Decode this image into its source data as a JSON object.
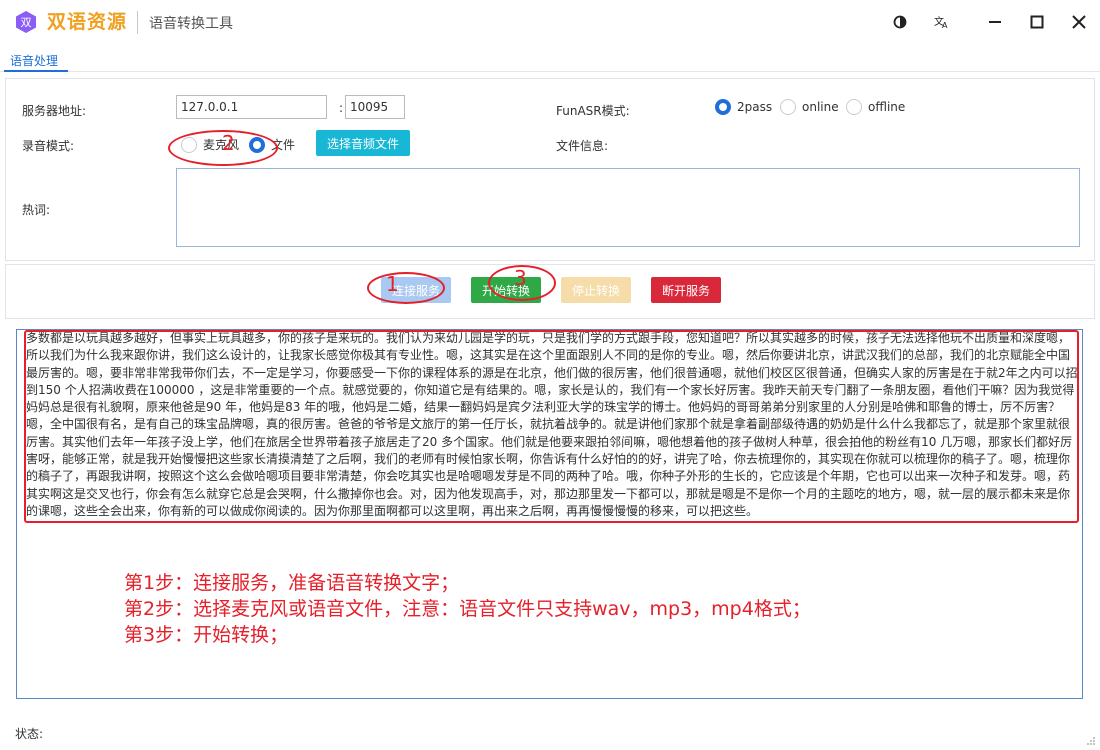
{
  "app": {
    "name": "双语资源",
    "logo_text": "双",
    "subtitle": "语音转换工具"
  },
  "titlebar": {
    "icons": [
      "theme-icon",
      "translate-icon",
      "minimize-icon",
      "maximize-icon",
      "close-icon"
    ]
  },
  "tabs": [
    {
      "label": "语音处理",
      "active": true
    }
  ],
  "form": {
    "server_label": "服务器地址:",
    "server_value": "127.0.0.1",
    "port_sep": ":",
    "port_value": "10095",
    "funasr_label": "FunASR模式:",
    "funasr_options": [
      "2pass",
      "online",
      "offline"
    ],
    "funasr_selected": "2pass",
    "record_label": "录音模式:",
    "record_options": [
      "麦克风",
      "文件"
    ],
    "record_selected": "文件",
    "select_file_button": "选择音频文件",
    "file_info_label": "文件信息:",
    "hotword_label": "热词:",
    "hotword_value": ""
  },
  "actions": {
    "connect": "连接服务",
    "start": "开始转换",
    "stop": "停止转换",
    "disconnect": "断开服务"
  },
  "annotations": {
    "num1": "1",
    "num2": "2",
    "num3": "3"
  },
  "transcript": "多数都是以玩具越多越好，但事实上玩具越多，你的孩子是来玩的。我们认为来幼儿园是学的玩，只是我们学的方式跟手段，您知道吧？所以其实越多的时候，孩子无法选择他玩不出质量和深度嗯，所以我们为什么我来跟你讲，我们这么设计的，让我家长感觉你极其有专业性。嗯，这其实是在这个里面跟别人不同的是你的专业。嗯，然后你要讲北京，讲武汉我们的总部，我们的北京赋能全中国最厉害的。嗯，要非常非常我带你们去，不一定是学习，你要感受一下你的课程体系的源是在北京，他们做的很厉害，他们很普通嗯，就他们校区区很普通，但确实人家的厉害是在于就2年之内可以招到150 个人招满收费在100000 ，这是非常重要的一个点。就感觉要的，你知道它是有结果的。嗯，家长是认的，我们有一个家长好厉害。我昨天前天专门翻了一条朋友圈，看他们干嘛？因为我觉得妈妈总是很有礼貌啊，原来他爸是90 年，他妈是83 年的哦，他妈是二婚，结果一翻妈妈是宾夕法利亚大学的珠宝学的博士。他妈妈的哥哥弟弟分别家里的人分别是哈佛和耶鲁的博士，厉不厉害？嗯，全中国很有名，是有自己的珠宝品牌嗯，真的很厉害。爸爸的爷爷是文旅厅的第一任厅长，就抗着战争的。就是讲他们家那个就是拿着副部级待遇的奶奶是什么什么我都忘了，就是那个家里就很厉害。其实他们去年一年孩子没上学，他们在旅居全世界带着孩子旅居走了20 多个国家。他们就是他要来跟拍邻间嘛，嗯他想着他的孩子做树人种草，很会拍他的粉丝有10 几万嗯，那家长们都好厉害呀，能够正常，就是我开始慢慢把这些家长清摸清楚了之后啊，我们的老师有时候怕家长啊，你告诉有什么好怕的的好，讲完了哈，你去梳理你的，其实现在你就可以梳理你的稿子了。嗯，梳理你的稿子了，再跟我讲啊，按照这个这么会做哈嗯项目要非常清楚，你会吃其实也是哈嗯嗯发芽是不同的两种了哈。哦，你种子外形的生长的，它应该是个年期，它也可以出来一次种子和发芽。嗯，药其实啊这是交叉也行，你会有怎么就穿它总是会哭啊，什么撒掉你也会。对，因为他发现高手，对，那边那里发一下都可以，那就是嗯是不是你一个月的主题吃的地方，嗯，就一层的展示都未来是你的课嗯，这些全会出来，你有新的可以做成你阅读的。因为你那里面啊都可以这里啊，再出来之后啊，再再慢慢慢慢的移来，可以把这些。",
  "steps": [
    "第1步：连接服务，准备语音转换文字；",
    "第2步：选择麦克风或语音文件，注意：语音文件只支持wav，mp3，mp4格式；",
    "第3步：开始转换；"
  ],
  "status": {
    "label": "状态:",
    "value": ""
  },
  "colors": {
    "accent": "#1e6fd9",
    "app_name": "#f0a020",
    "select_file_btn": "#19b7d6",
    "connect_btn": "#a9c8f2",
    "start_btn": "#2fa846",
    "stop_btn": "#f5dca8",
    "disconnect_btn": "#d9283a",
    "annotation": "#e6202a"
  }
}
